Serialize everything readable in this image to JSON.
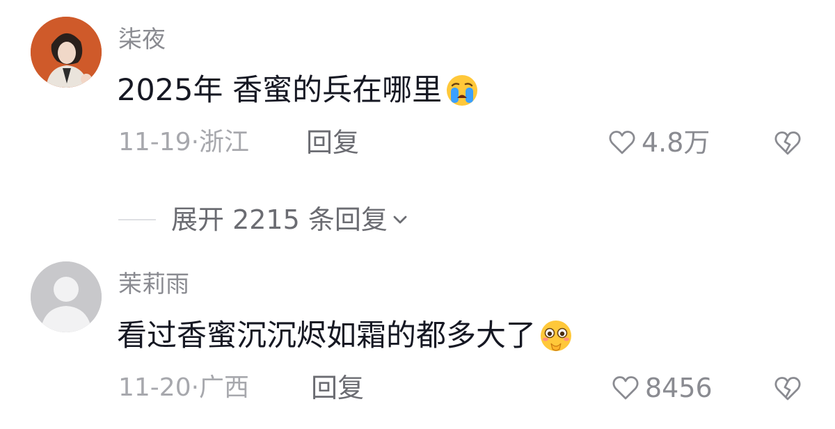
{
  "comments": [
    {
      "username": "柒夜",
      "text": "2025年 香蜜的兵在哪里",
      "emoji": "crying-face-icon",
      "date_location": "11-19·浙江",
      "reply_label": "回复",
      "likes": "4.8万"
    },
    {
      "username": "茉莉雨",
      "text": "看过香蜜沉沉烬如霜的都多大了",
      "emoji": "pleading-face-icon",
      "date_location": "11-20·广西",
      "reply_label": "回复",
      "likes": "8456"
    }
  ],
  "expand_replies": {
    "label": "展开 2215 条回复"
  },
  "colors": {
    "primary_text": "#161823",
    "secondary_text": "#8a8b91",
    "meta_text": "#a7a8ad",
    "emoji_yellow": "#ffc83a",
    "tear_blue": "#3aa0ff"
  }
}
